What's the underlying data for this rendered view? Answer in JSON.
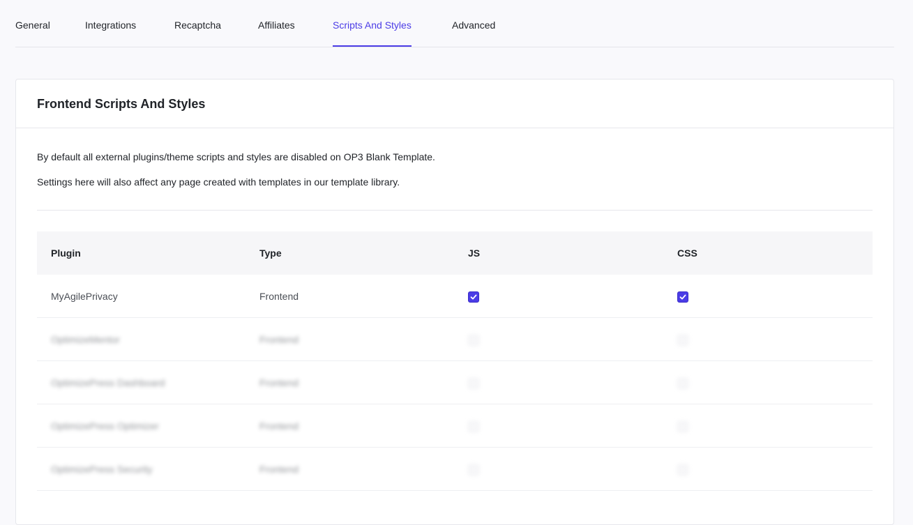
{
  "tabs": [
    {
      "label": "General",
      "active": false
    },
    {
      "label": "Integrations",
      "active": false
    },
    {
      "label": "Recaptcha",
      "active": false
    },
    {
      "label": "Affiliates",
      "active": false
    },
    {
      "label": "Scripts And Styles",
      "active": true
    },
    {
      "label": "Advanced",
      "active": false
    }
  ],
  "card": {
    "title": "Frontend Scripts And Styles",
    "desc1": "By default all external plugins/theme scripts and styles are disabled on OP3 Blank Template.",
    "desc2": "Settings here will also affect any page created with templates in our template library."
  },
  "table": {
    "headers": {
      "plugin": "Plugin",
      "type": "Type",
      "js": "JS",
      "css": "CSS"
    },
    "rows": [
      {
        "plugin": "MyAgilePrivacy",
        "type": "Frontend",
        "js": true,
        "css": true,
        "blurred": false
      },
      {
        "plugin": "OptimizeMentor",
        "type": "Frontend",
        "js": false,
        "css": false,
        "blurred": true
      },
      {
        "plugin": "OptimizePress Dashboard",
        "type": "Frontend",
        "js": false,
        "css": false,
        "blurred": true
      },
      {
        "plugin": "OptimizePress Optimizer",
        "type": "Frontend",
        "js": false,
        "css": false,
        "blurred": true
      },
      {
        "plugin": "OptimizePress Security",
        "type": "Frontend",
        "js": false,
        "css": false,
        "blurred": true
      }
    ]
  },
  "colors": {
    "accent": "#4b3ce6"
  }
}
